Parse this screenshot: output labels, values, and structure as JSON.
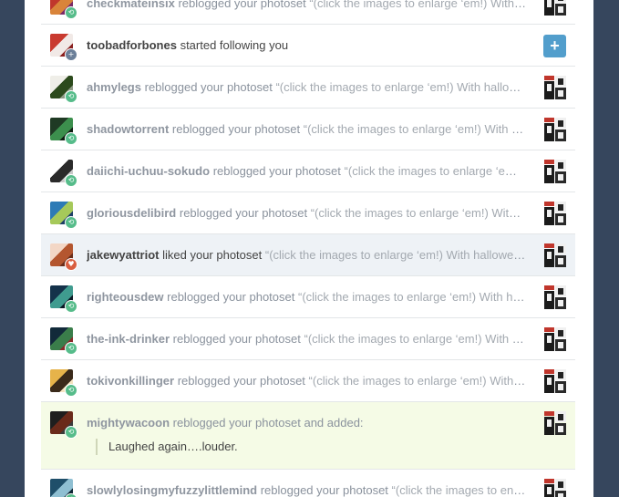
{
  "notifications": [
    {
      "type": "reblog",
      "user": "checkmateinsix",
      "action": "reblogged your photoset",
      "quote": "“(click the images to enlarge ‘em!) With halloween approaching…",
      "colors": [
        "#c0362c",
        "#d9843a",
        "#7a2a66"
      ]
    },
    {
      "type": "follow",
      "user": "toobadforbones",
      "action": "started following you",
      "colors": [
        "#c93a2f",
        "#f1e9e6",
        "#8a2020"
      ]
    },
    {
      "type": "reblog",
      "user": "ahmylegs",
      "action": "reblogged your photoset",
      "quote": "“(click the images to enlarge ‘em!) With halloween approaching…",
      "colors": [
        "#efeee8",
        "#2c4a1c",
        "#8f9a86"
      ]
    },
    {
      "type": "reblog",
      "user": "shadowtorrent",
      "action": "reblogged your photoset",
      "quote": "“(click the images to enlarge ‘em!) With halloween approaching…",
      "colors": [
        "#1f3a24",
        "#3c8f4d",
        "#0f1e12"
      ]
    },
    {
      "type": "reblog",
      "user": "daiichi-uchuu-sokudo",
      "action": "reblogged your photoset",
      "quote": "“(click the images to enlarge ‘em!) With halloween approaching…",
      "colors": [
        "#ffffff",
        "#2a2a2a",
        "#c9c9c9"
      ]
    },
    {
      "type": "reblog",
      "user": "gloriousdelibird",
      "action": "reblogged your photoset",
      "quote": "“(click the images to enlarge ‘em!) With halloween approaching…",
      "colors": [
        "#2d7bb6",
        "#a6c95a",
        "#1d3f66"
      ]
    },
    {
      "type": "like",
      "user": "jakewyattriot",
      "action": "liked your photoset",
      "quote": "“(click the images to enlarge ‘em!) With halloween approaching…",
      "colors": [
        "#f3d7c6",
        "#b4562f",
        "#6a2d1a"
      ]
    },
    {
      "type": "reblog",
      "user": "righteousdew",
      "action": "reblogged your photoset",
      "quote": "“(click the images to enlarge ‘em!) With halloween approaching…",
      "colors": [
        "#14324a",
        "#3f9b8f",
        "#0b1a26"
      ]
    },
    {
      "type": "reblog",
      "user": "the-ink-drinker",
      "action": "reblogged your photoset",
      "quote": "“(click the images to enlarge ‘em!) With halloween approaching…",
      "colors": [
        "#122a3a",
        "#3a7d4a",
        "#8a2a2a"
      ]
    },
    {
      "type": "reblog",
      "user": "tokivonkillinger",
      "action": "reblogged your photoset",
      "quote": "“(click the images to enlarge ‘em!) With halloween approaching…",
      "colors": [
        "#e6b34a",
        "#3a2a1a",
        "#f5e3c0"
      ]
    },
    {
      "type": "added",
      "user": "mightywacoon",
      "action": "reblogged your photoset and added:",
      "added_text": "Laughed again….louder.",
      "colors": [
        "#1e1e1e",
        "#6a2a1a",
        "#3a3a3a"
      ]
    },
    {
      "type": "reblog",
      "user": "slowlylosingmyfuzzylittlemind",
      "action": "reblogged your photoset",
      "quote": "“(click the images to enlarge ‘em!) With halloween approaching…",
      "colors": [
        "#1f4f6a",
        "#8fbfd2",
        "#0e2633"
      ]
    }
  ],
  "follow_button_glyph": "+",
  "badge_glyphs": {
    "reblog": "⟲",
    "follow": "+",
    "like": "♥"
  },
  "accent": {
    "blue": "#529ecc",
    "reblog_green": "#56bc8a",
    "like_red": "#d95e40",
    "background": "#36465d"
  }
}
